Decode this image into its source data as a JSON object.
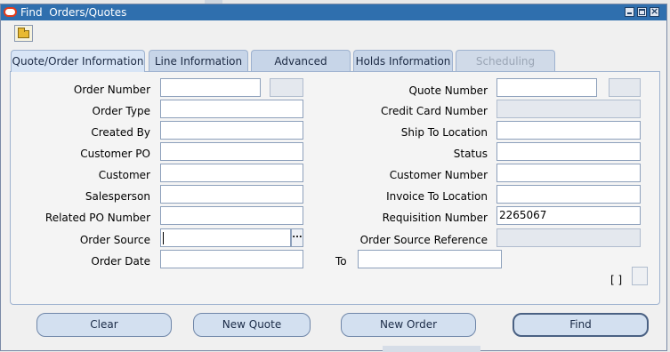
{
  "window": {
    "title": "Find  Orders/Quotes"
  },
  "tabs": [
    {
      "label": "Quote/Order Information",
      "state": "active"
    },
    {
      "label": "Line Information",
      "state": "normal"
    },
    {
      "label": "Advanced",
      "state": "normal"
    },
    {
      "label": "Holds Information",
      "state": "normal"
    },
    {
      "label": "Scheduling",
      "state": "disabled"
    }
  ],
  "left_fields": [
    {
      "label": "Order Number",
      "value": ""
    },
    {
      "label": "Order Type",
      "value": ""
    },
    {
      "label": "Created By",
      "value": ""
    },
    {
      "label": "Customer PO",
      "value": ""
    },
    {
      "label": "Customer",
      "value": ""
    },
    {
      "label": "Salesperson",
      "value": ""
    },
    {
      "label": "Related PO Number",
      "value": ""
    },
    {
      "label": "Order Source",
      "value": ""
    },
    {
      "label": "Order Date",
      "value": ""
    }
  ],
  "right_fields": [
    {
      "label": "Quote Number",
      "value": ""
    },
    {
      "label": "Credit Card Number",
      "value": ""
    },
    {
      "label": "Ship To Location",
      "value": ""
    },
    {
      "label": "Status",
      "value": ""
    },
    {
      "label": "Customer Number",
      "value": ""
    },
    {
      "label": "Invoice To Location",
      "value": ""
    },
    {
      "label": "Requisition Number",
      "value": "2265067"
    },
    {
      "label": "Order Source Reference",
      "value": ""
    }
  ],
  "to_label": "To",
  "to_value": "",
  "lov_button": "...",
  "bracket_text": "[ ]",
  "buttons": {
    "clear": "Clear",
    "new_quote": "New Quote",
    "new_order": "New Order",
    "find": "Find"
  },
  "icons": {
    "app": "oracle-icon",
    "toolbar": "open-folder-icon"
  }
}
